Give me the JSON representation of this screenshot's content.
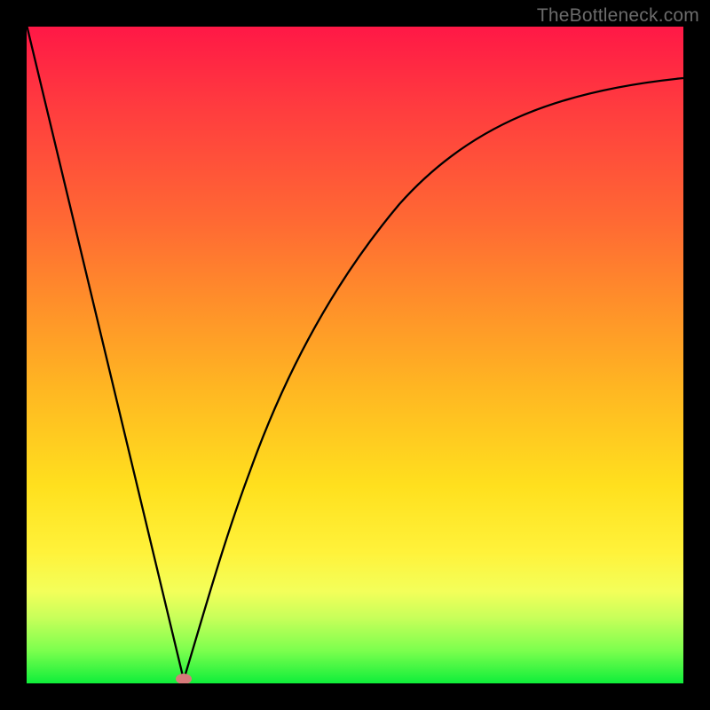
{
  "watermark": "TheBottleneck.com",
  "chart_data": {
    "type": "line",
    "title": "",
    "xlabel": "",
    "ylabel": "",
    "xlim": [
      0,
      1
    ],
    "ylim": [
      0,
      1
    ],
    "x": [
      0.0,
      0.05,
      0.1,
      0.15,
      0.18,
      0.2,
      0.22,
      0.24,
      0.26,
      0.28,
      0.3,
      0.32,
      0.36,
      0.4,
      0.45,
      0.5,
      0.55,
      0.6,
      0.65,
      0.7,
      0.75,
      0.8,
      0.85,
      0.9,
      0.95,
      1.0
    ],
    "y": [
      1.0,
      0.79,
      0.58,
      0.36,
      0.24,
      0.15,
      0.06,
      0.0,
      0.02,
      0.08,
      0.16,
      0.24,
      0.38,
      0.49,
      0.6,
      0.68,
      0.74,
      0.79,
      0.82,
      0.85,
      0.87,
      0.89,
      0.9,
      0.91,
      0.92,
      0.925
    ],
    "min_point": {
      "x": 0.24,
      "y": 0.0
    },
    "background_gradient": {
      "top": "#ff1846",
      "mid_upper": "#ff8f2a",
      "mid_lower": "#ffe01e",
      "bottom": "#0fee3a"
    }
  }
}
